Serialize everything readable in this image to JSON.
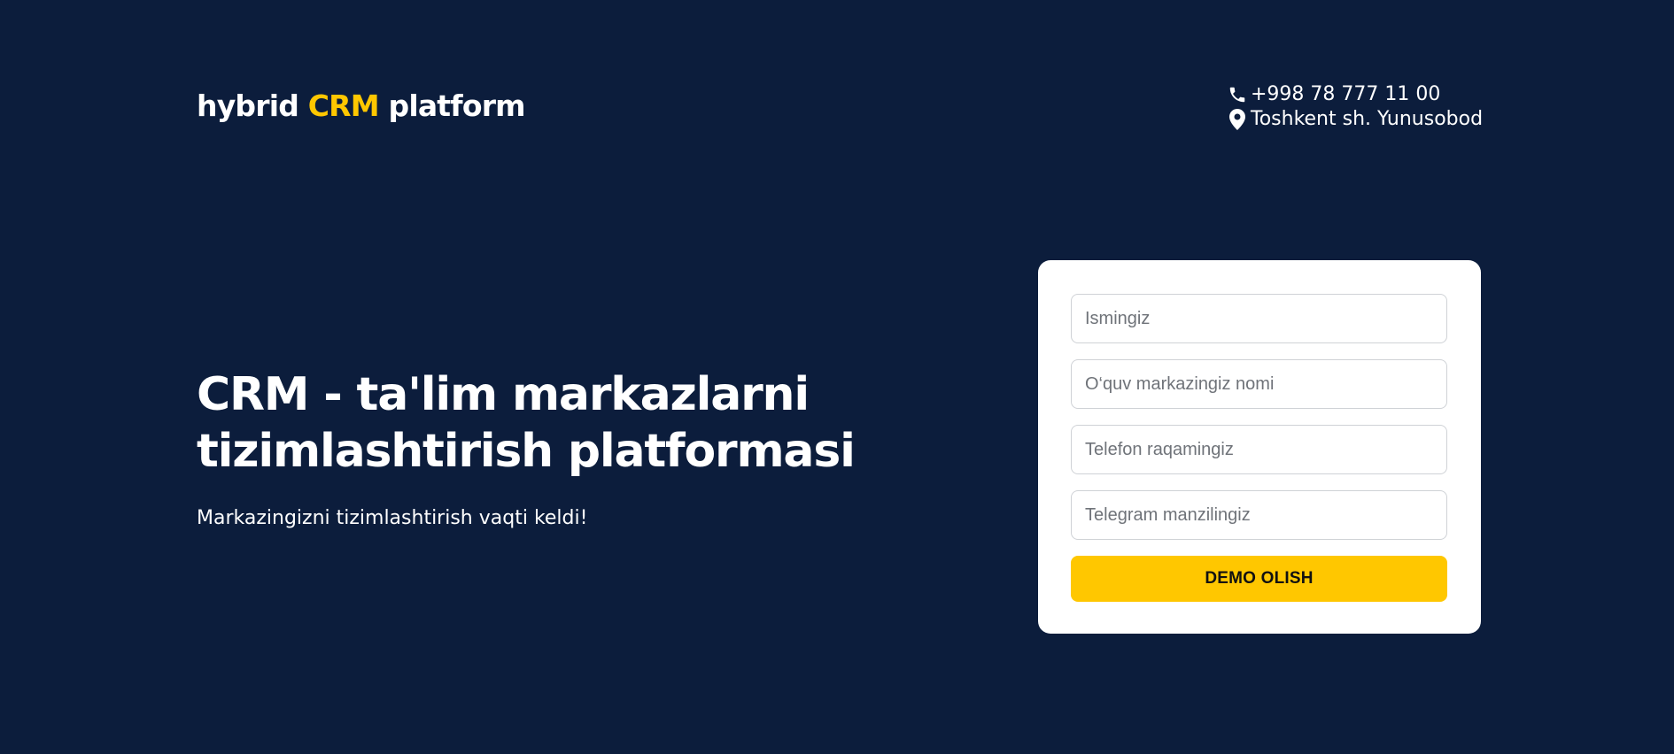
{
  "header": {
    "logo": {
      "part1": "hybrid ",
      "accent": "CRM",
      "part2": " platform"
    },
    "phone": "+998 78 777 11 00",
    "address": "Toshkent sh. Yunusobod",
    "icons": {
      "phone": "phone-icon",
      "location": "location-pin-icon"
    }
  },
  "hero": {
    "title_line1": "CRM - ta'lim markazlarni",
    "title_line2": "tizimlashtirish platformasi",
    "subtitle": "Markazingizni tizimlashtirish vaqti keldi!"
  },
  "form": {
    "name_placeholder": "Ismingiz",
    "center_placeholder": "O‘quv markazingiz nomi",
    "phone_placeholder": "Telefon raqamingiz",
    "telegram_placeholder": "Telegram manzilingiz",
    "submit_label": "DEMO OLISH"
  },
  "colors": {
    "background": "#0c1d3c",
    "accent": "#ffc700",
    "card": "#ffffff"
  }
}
